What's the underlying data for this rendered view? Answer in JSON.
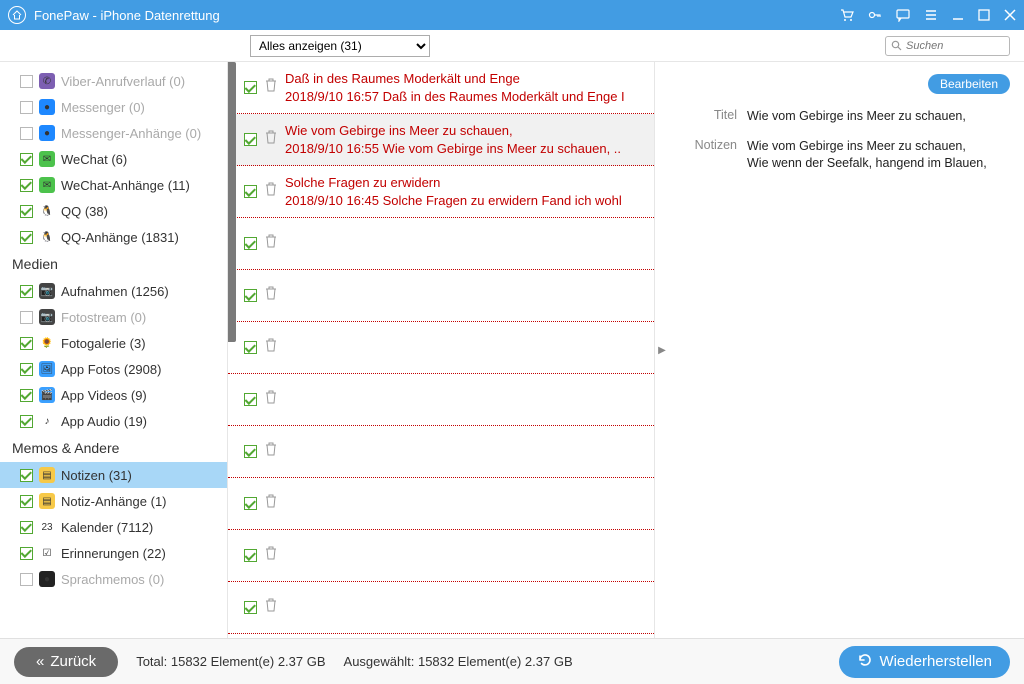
{
  "app_title": "FonePaw - iPhone Datenrettung",
  "toolbar": {
    "filter_label": "Alles anzeigen (31)",
    "search_placeholder": "Suchen"
  },
  "sidebar": {
    "items_before": [
      {
        "label": "Viber-Anrufverlauf (0)",
        "checked": false,
        "icon_bg": "#7d5fb2",
        "icon_glyph": "✆"
      },
      {
        "label": "Messenger (0)",
        "checked": false,
        "icon_bg": "#1e88ff",
        "icon_glyph": "●"
      },
      {
        "label": "Messenger-Anhänge (0)",
        "checked": false,
        "icon_bg": "#1e88ff",
        "icon_glyph": "●"
      },
      {
        "label": "WeChat (6)",
        "checked": true,
        "icon_bg": "#4cc24c",
        "icon_glyph": "✉"
      },
      {
        "label": "WeChat-Anhänge (11)",
        "checked": true,
        "icon_bg": "#4cc24c",
        "icon_glyph": "✉"
      },
      {
        "label": "QQ (38)",
        "checked": true,
        "icon_bg": "#fff",
        "icon_glyph": "🐧"
      },
      {
        "label": "QQ-Anhänge (1831)",
        "checked": true,
        "icon_bg": "#fff",
        "icon_glyph": "🐧"
      }
    ],
    "group_media": "Medien",
    "items_media": [
      {
        "label": "Aufnahmen (1256)",
        "checked": true,
        "icon_bg": "#444",
        "icon_glyph": "📷"
      },
      {
        "label": "Fotostream (0)",
        "checked": false,
        "icon_bg": "#444",
        "icon_glyph": "📷"
      },
      {
        "label": "Fotogalerie (3)",
        "checked": true,
        "icon_bg": "#fff",
        "icon_glyph": "🌻"
      },
      {
        "label": "App Fotos (2908)",
        "checked": true,
        "icon_bg": "#3aa0ff",
        "icon_glyph": "🖼"
      },
      {
        "label": "App Videos (9)",
        "checked": true,
        "icon_bg": "#3aa0ff",
        "icon_glyph": "🎬"
      },
      {
        "label": "App Audio (19)",
        "checked": true,
        "icon_bg": "#fff",
        "icon_glyph": "♪"
      }
    ],
    "group_memos": "Memos & Andere",
    "items_memos": [
      {
        "label": "Notizen (31)",
        "checked": true,
        "icon_bg": "#f7c948",
        "icon_glyph": "▤",
        "selected": true
      },
      {
        "label": "Notiz-Anhänge (1)",
        "checked": true,
        "icon_bg": "#f7c948",
        "icon_glyph": "▤"
      },
      {
        "label": "Kalender (7112)",
        "checked": true,
        "icon_bg": "#fff",
        "icon_glyph": "23"
      },
      {
        "label": "Erinnerungen (22)",
        "checked": true,
        "icon_bg": "#fff",
        "icon_glyph": "☑"
      },
      {
        "label": "Sprachmemos (0)",
        "checked": false,
        "icon_bg": "#222",
        "icon_glyph": "●"
      }
    ]
  },
  "list": [
    {
      "title": "Daß in des Raumes Moderkält und Enge",
      "date": "2018/9/10 16:57",
      "snippet": "Daß in des Raumes Moderkält und Enge I",
      "selected": false
    },
    {
      "title": "Wie vom Gebirge ins Meer zu schauen,",
      "date": "2018/9/10 16:55",
      "snippet": "Wie vom Gebirge ins Meer zu schauen, ..",
      "selected": true
    },
    {
      "title": "Solche Fragen zu erwidern",
      "date": "2018/9/10 16:45",
      "snippet": "Solche Fragen zu erwidern Fand ich wohl",
      "selected": false
    },
    {
      "title": "",
      "date": "",
      "snippet": ""
    },
    {
      "title": "",
      "date": "",
      "snippet": ""
    },
    {
      "title": "",
      "date": "",
      "snippet": ""
    },
    {
      "title": "",
      "date": "",
      "snippet": ""
    },
    {
      "title": "",
      "date": "",
      "snippet": ""
    },
    {
      "title": "",
      "date": "",
      "snippet": ""
    },
    {
      "title": "",
      "date": "",
      "snippet": ""
    },
    {
      "title": "",
      "date": "",
      "snippet": ""
    }
  ],
  "detail": {
    "edit": "Bearbeiten",
    "title_key": "Titel",
    "title_val": "Wie vom Gebirge ins Meer zu schauen,",
    "notes_key": "Notizen",
    "notes_val": "Wie vom Gebirge ins Meer zu schauen,\nWie wenn der Seefalk, hangend im Blauen,"
  },
  "footer": {
    "back": "Zurück",
    "total": "Total: 15832 Element(e) 2.37 GB",
    "selected": "Ausgewählt: 15832 Element(e) 2.37 GB",
    "recover": "Wiederherstellen"
  }
}
